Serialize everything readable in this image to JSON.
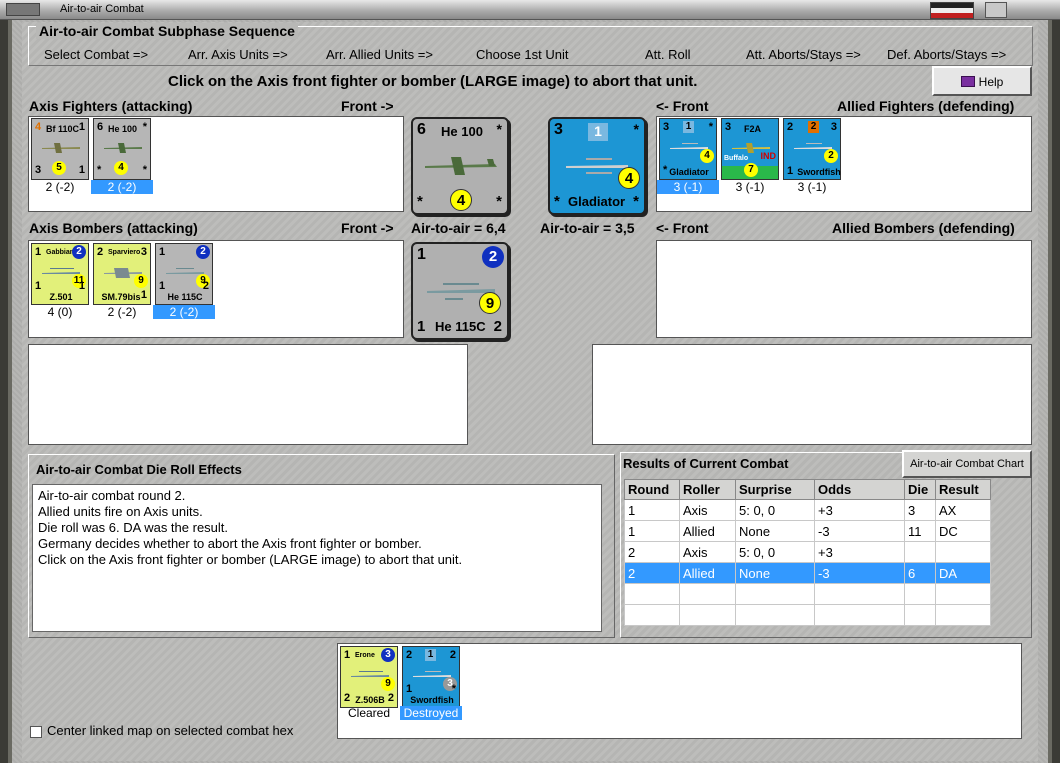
{
  "window": {
    "title": "Air-to-air Combat"
  },
  "sequence": {
    "title": "Air-to-air Combat Subphase Sequence",
    "steps": [
      "Select Combat =>",
      "Arr. Axis Units =>",
      "Arr. Allied Units =>",
      "Choose 1st Unit",
      "Att. Roll",
      "Att. Aborts/Stays =>",
      "Def. Aborts/Stays =>"
    ]
  },
  "instruction": "Click on the Axis front fighter or bomber  (LARGE image) to abort that unit.",
  "help_label": "Help",
  "axis_fighters": {
    "label": "Axis Fighters (attacking)",
    "front_label": "Front ->",
    "units": [
      {
        "tl": "4",
        "name": "Bf 110C",
        "tr": "1",
        "bl": "3",
        "mid": "5",
        "br": "1",
        "caption": "2 (-2)",
        "selected": false
      },
      {
        "tl": "6",
        "name": "He 100",
        "tr": "*",
        "bl": "*",
        "mid": "4",
        "br": "*",
        "caption": "2 (-2)",
        "selected": true
      }
    ]
  },
  "axis_front_fighter": {
    "tl": "6",
    "name": "He 100",
    "tr": "*",
    "bl": "*",
    "mid": "4",
    "br": "*"
  },
  "allied_front_fighter": {
    "tl": "3",
    "badge": "1",
    "name": "Gladiator",
    "tr": "*",
    "bl": "*",
    "mid": "4",
    "br": "*"
  },
  "allied_fighters": {
    "label": "Allied Fighters (defending)",
    "front_label": "<- Front",
    "units": [
      {
        "tl": "3",
        "badge": "1",
        "name": "Gladiator",
        "tr": "*",
        "bl": "*",
        "mid": "4",
        "br": "",
        "caption": "3 (-1)",
        "selected": true
      },
      {
        "tl": "3",
        "badge": "",
        "name": "F2A",
        "sub": "Buffalo",
        "tag": "IND",
        "tr": "",
        "bl": "",
        "mid": "7",
        "br": "",
        "caption": "3 (-1)",
        "selected": false
      },
      {
        "tl": "2",
        "badge": "2",
        "name": "Swordfish",
        "tr": "3",
        "bl": "1",
        "mid": "2",
        "br": "",
        "caption": "3 (-1)",
        "selected": false
      }
    ]
  },
  "axis_bombers": {
    "label": "Axis Bombers (attacking)",
    "front_label": "Front ->",
    "air_to_air": "Air-to-air = 6,4",
    "units": [
      {
        "tl": "1",
        "name": "Gabbiano",
        "tr": "2",
        "bl": "1",
        "mid": "11",
        "br": "1",
        "bname": "Z.501",
        "caption": "4 (0)",
        "selected": false
      },
      {
        "tl": "2",
        "name": "Sparviero",
        "tr": "3",
        "bl": "",
        "mid": "9",
        "br": "1",
        "bname": "SM.79bis",
        "caption": "2 (-2)",
        "selected": false
      },
      {
        "tl": "1",
        "name": "",
        "tr": "2",
        "bl": "1",
        "mid": "9",
        "br": "2",
        "bname": "He 115C",
        "caption": "2 (-2)",
        "selected": true
      }
    ]
  },
  "axis_front_bomber": {
    "tl": "1",
    "tr": "2",
    "mid": "9",
    "bl": "1",
    "name": "He 115C",
    "br": "2"
  },
  "allied_bombers": {
    "label": "Allied Bombers (defending)",
    "front_label": "<- Front",
    "air_to_air": "Air-to-air = 3,5"
  },
  "effects": {
    "title": "Air-to-air Combat Die Roll Effects",
    "lines": [
      "Air-to-air combat round 2.",
      "Allied units fire on Axis units.",
      "Die roll was 6.  DA was the result.",
      "Germany decides whether to abort the Axis front fighter or bomber.",
      "Click on the Axis front fighter or bomber  (LARGE image) to abort that unit."
    ]
  },
  "results": {
    "title": "Results of Current Combat",
    "chart_button": "Air-to-air Combat Chart",
    "columns": [
      "Round",
      "Roller",
      "Surprise",
      "Odds",
      "Die",
      "Result"
    ],
    "rows": [
      [
        "1",
        "Axis",
        "5: 0, 0",
        "+3",
        "3",
        "AX"
      ],
      [
        "1",
        "Allied",
        "None",
        "-3",
        "11",
        "DC"
      ],
      [
        "2",
        "Axis",
        "5: 0, 0",
        "+3",
        "",
        ""
      ],
      [
        "2",
        "Allied",
        "None",
        "-3",
        "6",
        "DA"
      ],
      [
        "",
        "",
        "",
        "",
        "",
        ""
      ],
      [
        "",
        "",
        "",
        "",
        "",
        ""
      ]
    ],
    "selected_row": 3
  },
  "removed": [
    {
      "tl": "1",
      "name": "Erone",
      "tr": "3",
      "bl": "2",
      "mid": "9",
      "br": "2",
      "bname": "Z.506B",
      "caption": "Cleared",
      "selected": false
    },
    {
      "tl": "2",
      "badge": "1",
      "name": "Swordfish",
      "tr": "2",
      "bl": "1",
      "mid": "3",
      "br": "*",
      "caption": "Destroyed",
      "selected": true
    }
  ],
  "center_map_label": "Center linked map on selected combat hex"
}
